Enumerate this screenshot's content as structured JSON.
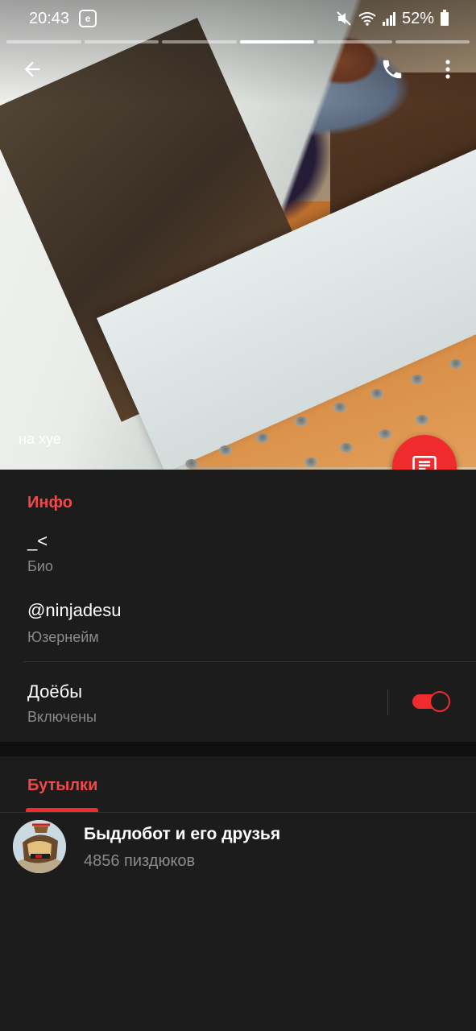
{
  "status_bar": {
    "time": "20:43",
    "badge": "e",
    "battery": "52%",
    "icons": [
      "mute-icon",
      "wifi-icon",
      "signal-icon",
      "battery-icon"
    ]
  },
  "story_progress": {
    "segments": 6,
    "active_index": 3
  },
  "app_bar": {
    "back_icon": "back-arrow-icon",
    "call_icon": "phone-icon",
    "more_icon": "more-vertical-icon"
  },
  "photo": {
    "caption": "на хуе"
  },
  "fab": {
    "icon": "message-icon"
  },
  "info": {
    "title": "Инфо",
    "bio_value": "_<",
    "bio_label": "Био",
    "username_value": "@ninjadesu",
    "username_label": "Юзернейм",
    "notifications_label": "Доёбы",
    "notifications_state": "Включены",
    "notifications_on": true
  },
  "groups": {
    "tab_label": "Бутылки",
    "items": [
      {
        "name": "Быдлобот и его друзья",
        "subtitle": "4856 пиздюков"
      }
    ]
  },
  "colors": {
    "accent": "#ef2b2d",
    "accent_text": "#f0494a",
    "background": "#1c1c1c",
    "secondary_text": "#8a8a8a"
  }
}
